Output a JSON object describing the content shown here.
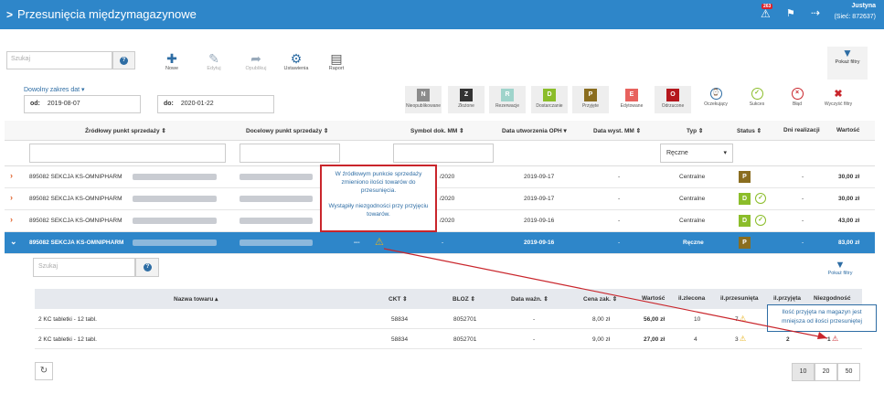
{
  "header": {
    "title": "Przesunięcia międzymagazynowe",
    "notifications_count": "263",
    "user_name": "Justyna",
    "network": "(Sieć: 872637)"
  },
  "toolbar": {
    "search_placeholder": "Szukaj",
    "buttons": [
      "Nowe",
      "Edytuj",
      "Opublikuj",
      "Ustawienia",
      "Raport"
    ],
    "show_filters": "Pokaż filtry"
  },
  "dates": {
    "range_label": "Dowolny zakres dat",
    "from_label": "od:",
    "from_value": "2019-08-07",
    "to_label": "do:",
    "to_value": "2020-01-22"
  },
  "status_filters": [
    {
      "letter": "N",
      "label": "Nieopublikowane",
      "color": "#8c8c8c"
    },
    {
      "letter": "Z",
      "label": "Złożone",
      "color": "#333333"
    },
    {
      "letter": "R",
      "label": "Rezerwacje",
      "color": "#9fd4cb"
    },
    {
      "letter": "D",
      "label": "Dostarczanie",
      "color": "#8bbd2a"
    },
    {
      "letter": "P",
      "label": "Przyjęte",
      "color": "#8a6d1f"
    },
    {
      "letter": "E",
      "label": "Edytowane",
      "color": "#e8625e"
    },
    {
      "letter": "O",
      "label": "Odrzucone",
      "color": "#b5171d"
    }
  ],
  "state_filters": [
    {
      "label": "Oczekujący",
      "color": "#2e6da4"
    },
    {
      "label": "Sukces",
      "color": "#8bbd2a"
    },
    {
      "label": "Błąd",
      "color": "#c9252b"
    },
    {
      "label": "Wyczyść filtry",
      "color": "#c9252b"
    }
  ],
  "columns": [
    "Źródłowy punkt sprzedaży",
    "Docelowy punkt sprzedaży",
    "Symbol dok. MM",
    "Data utworzenia OPH",
    "Data wyst. MM",
    "Typ",
    "Status",
    "Dni realizacji",
    "Wartość"
  ],
  "type_filter": "Ręczne",
  "rows": [
    {
      "source": "895082 SEKCJA KS-OMNIPHARM",
      "symbol": "/2020",
      "created": "2019-09-17",
      "issued": "-",
      "type": "Centralne",
      "status": "P",
      "status_color": "#8a6d1f",
      "days": "-",
      "value": "30,00 zł"
    },
    {
      "source": "895082 SEKCJA KS-OMNIPHARM",
      "symbol": "/2020",
      "created": "2019-09-17",
      "issued": "-",
      "type": "Centralne",
      "status": "D",
      "status_color": "#8bbd2a",
      "days": "-",
      "value": "30,00 zł"
    },
    {
      "source": "895082 SEKCJA KS-OMNIPHARM",
      "symbol": "/2020",
      "created": "2019-09-16",
      "issued": "-",
      "type": "Centralne",
      "status": "D",
      "status_color": "#8bbd2a",
      "days": "-",
      "value": "43,00 zł"
    },
    {
      "source": "895082 SEKCJA KS-OMNIPHARM",
      "symbol": "---",
      "created": "2019-09-16",
      "issued": "-",
      "type": "Ręczne",
      "status": "P",
      "status_color": "#8a6d1f",
      "days": "-",
      "value": "83,00 zł"
    }
  ],
  "tooltip": {
    "line1": "W źródłowym punkcie sprzedaży zmieniono ilości towarów do przesunięcia.",
    "line2": "Wystąpiły niezgodności przy przyjęciu towarów."
  },
  "detail": {
    "search_placeholder": "Szukaj",
    "show_filters": "Pokaż filtry",
    "columns": [
      "Nazwa towaru",
      "CKT",
      "BLOZ",
      "Data ważn.",
      "Cena zak.",
      "Wartość",
      "il.zlecona",
      "il.przesunięta",
      "il.przyjęta",
      "Niezgodność"
    ],
    "items": [
      {
        "name": "2 KC tabletki - 12 tabl.",
        "ckt": "58834",
        "bloz": "8052701",
        "expiry": "-",
        "price": "8,00 zł",
        "value": "56,00 zł",
        "ordered": "10",
        "moved": "7",
        "received": "",
        "mismatch": ""
      },
      {
        "name": "2 KC tabletki - 12 tabl.",
        "ckt": "58834",
        "bloz": "8052701",
        "expiry": "-",
        "price": "9,00 zł",
        "value": "27,00 zł",
        "ordered": "4",
        "moved": "3",
        "received": "2",
        "mismatch": "1"
      }
    ],
    "note": "Ilość przyjęta na magazyn jest mniejsza od ilości przesuniętej",
    "pages": [
      "10",
      "20",
      "50"
    ]
  }
}
